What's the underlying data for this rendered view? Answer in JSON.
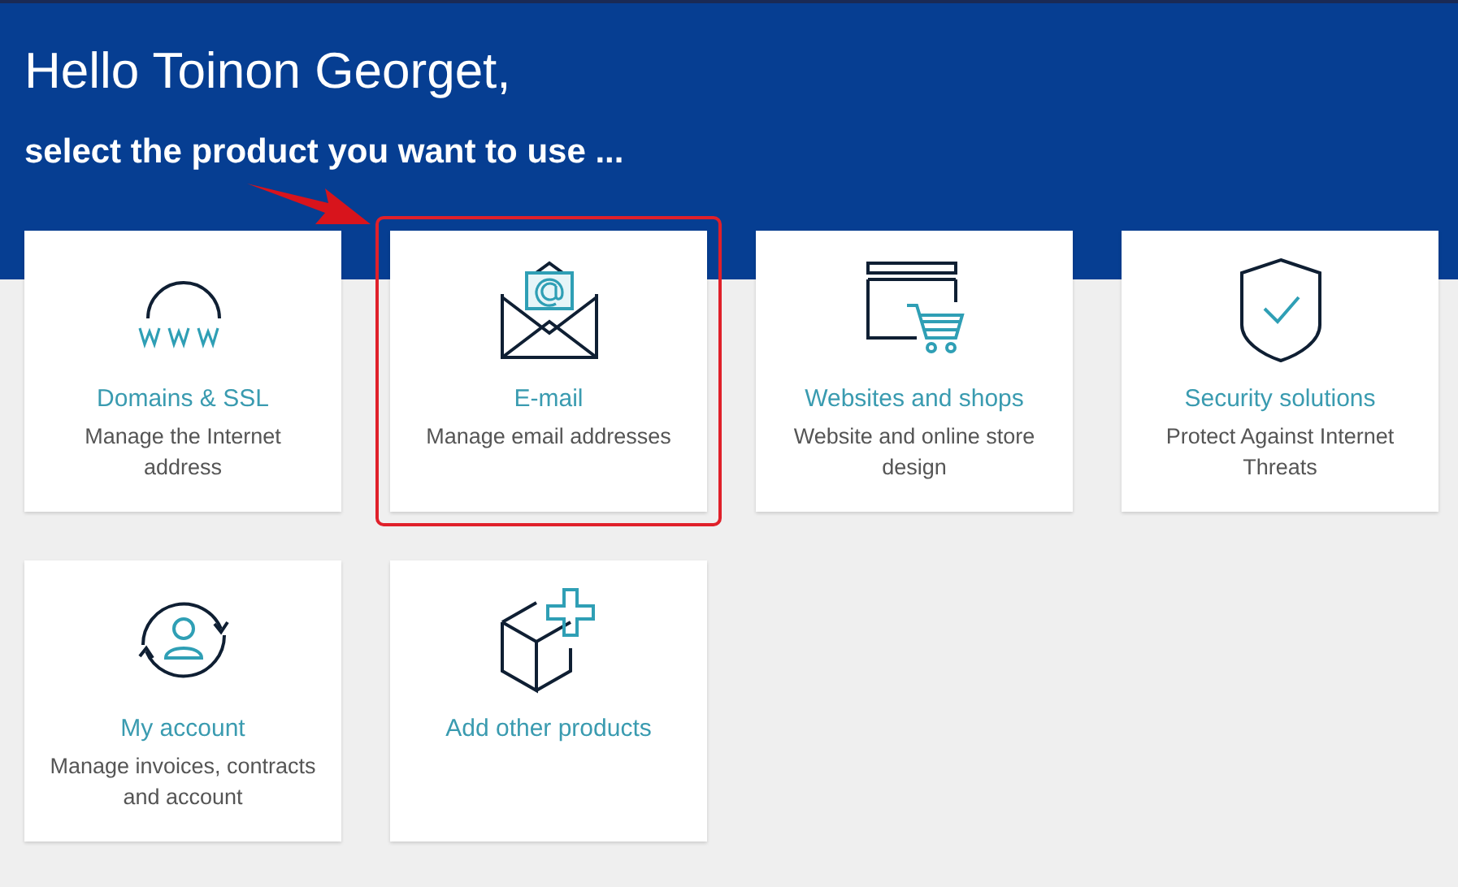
{
  "header": {
    "greeting": "Hello Toinon Georget,",
    "subtitle": "select the product you want to use ..."
  },
  "annotation": {
    "arrow": true
  },
  "products": [
    {
      "kind": "domains",
      "title": "Domains & SSL",
      "description": "Manage the Internet address",
      "highlighted": false
    },
    {
      "kind": "email",
      "title": "E-mail",
      "description": "Manage email addresses",
      "highlighted": true
    },
    {
      "kind": "websites",
      "title": "Websites and shops",
      "description": "Website and online store design",
      "highlighted": false
    },
    {
      "kind": "security",
      "title": "Security solutions",
      "description": "Protect Against Internet Threats",
      "highlighted": false
    },
    {
      "kind": "account",
      "title": "My account",
      "description": "Manage invoices, contracts and account",
      "highlighted": false
    },
    {
      "kind": "add",
      "title": "Add other products",
      "highlighted": false
    }
  ]
}
